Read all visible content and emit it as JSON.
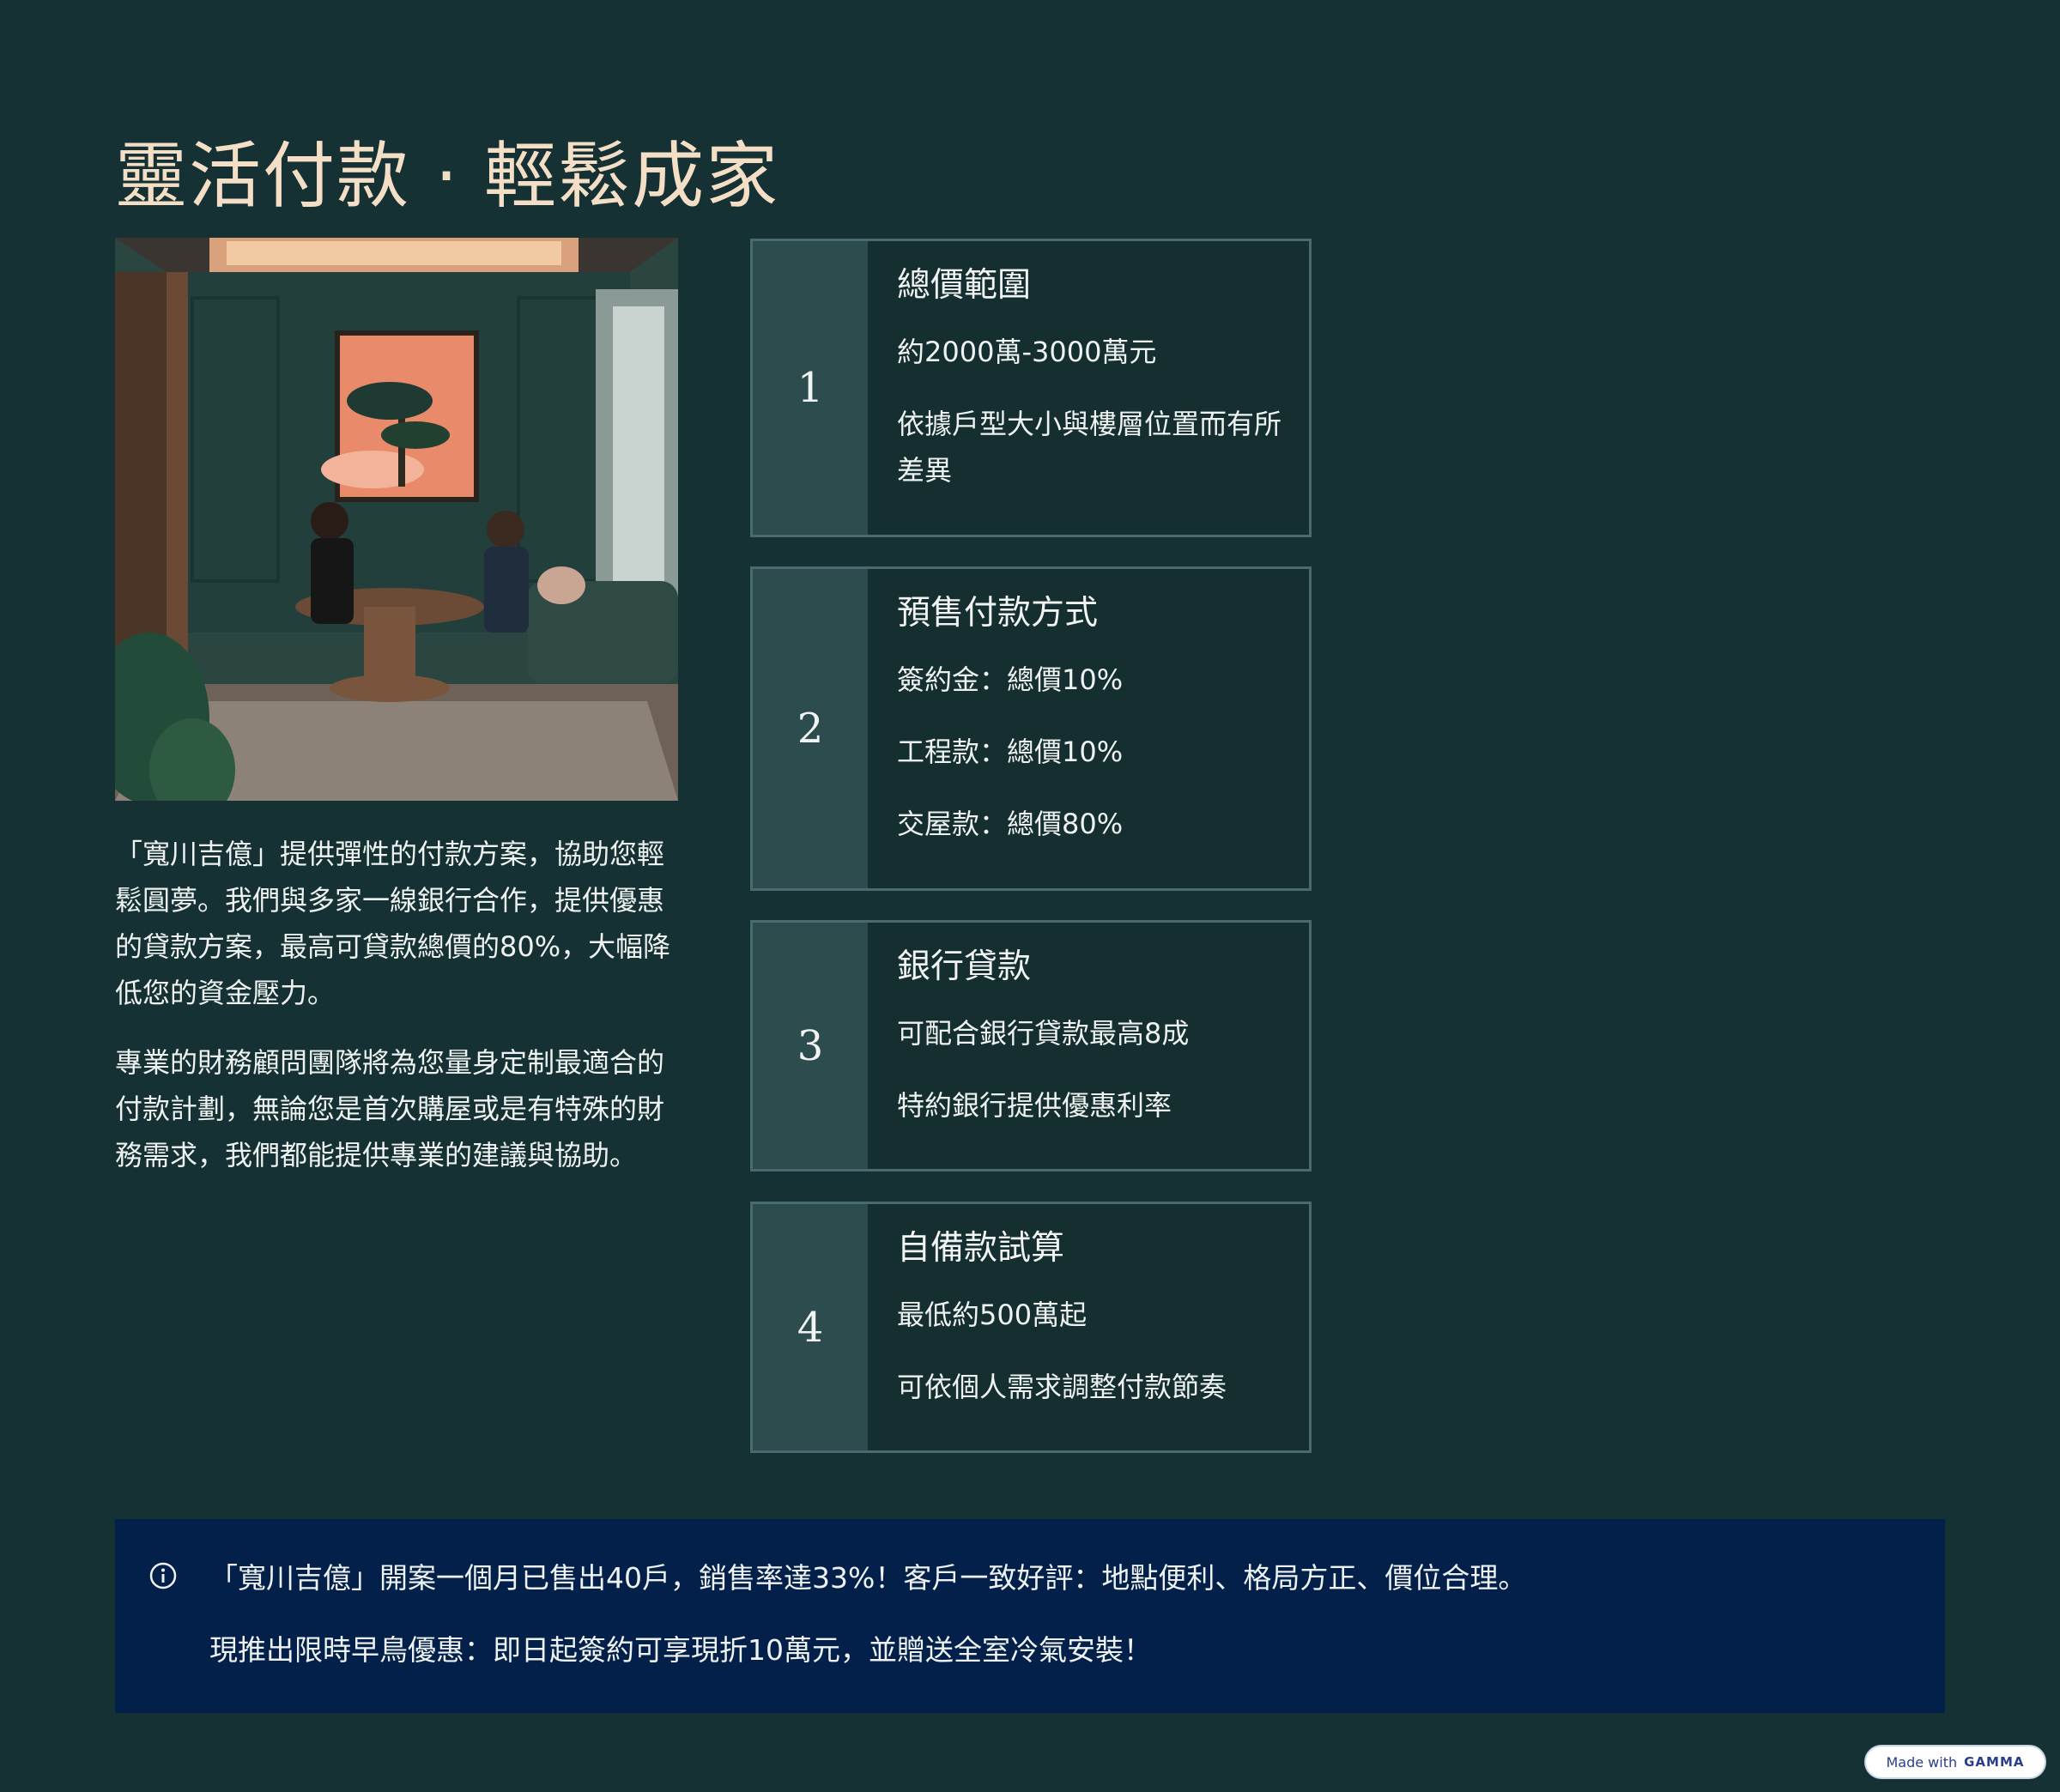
{
  "header": {
    "title": "靈活付款 · 輕鬆成家"
  },
  "intro": {
    "paragraph1": "「寬川吉億」提供彈性的付款方案，協助您輕鬆圓夢。我們與多家一線銀行合作，提供優惠的貸款方案，最高可貸款總價的80%，大幅降低您的資金壓力。",
    "paragraph2": "專業的財務顧問團隊將為您量身定制最適合的付款計劃，無論您是首次購屋或是有特殊的財務需求，我們都能提供專業的建議與協助。"
  },
  "steps": [
    {
      "number": "1",
      "heading": "總價範圍",
      "lines": [
        "約2000萬-3000萬元",
        "依據戶型大小與樓層位置而有所差異"
      ]
    },
    {
      "number": "2",
      "heading": "預售付款方式",
      "lines": [
        "簽約金：總價10%",
        "工程款：總價10%",
        "交屋款：總價80%"
      ]
    },
    {
      "number": "3",
      "heading": "銀行貸款",
      "lines": [
        "可配合銀行貸款最高8成",
        "特約銀行提供優惠利率"
      ]
    },
    {
      "number": "4",
      "heading": "自備款試算",
      "lines": [
        "最低約500萬起",
        "可依個人需求調整付款節奏"
      ]
    }
  ],
  "notice": {
    "icon": "info-icon",
    "line1": "「寬川吉億」開案一個月已售出40戶，銷售率達33%！客戶一致好評：地點便利、格局方正、價位合理。",
    "line2": "現推出限時早鳥優惠：即日起簽約可享現折10萬元，並贈送全室冷氣安裝！"
  },
  "badge": {
    "prefix": "Made with",
    "brand": "GAMMA"
  },
  "colors": {
    "background": "#153134",
    "title": "#f4dfc6",
    "step_number_bg": "#2d4c4e",
    "step_border": "#4b6a6d",
    "notice_bg": "#03204a"
  }
}
